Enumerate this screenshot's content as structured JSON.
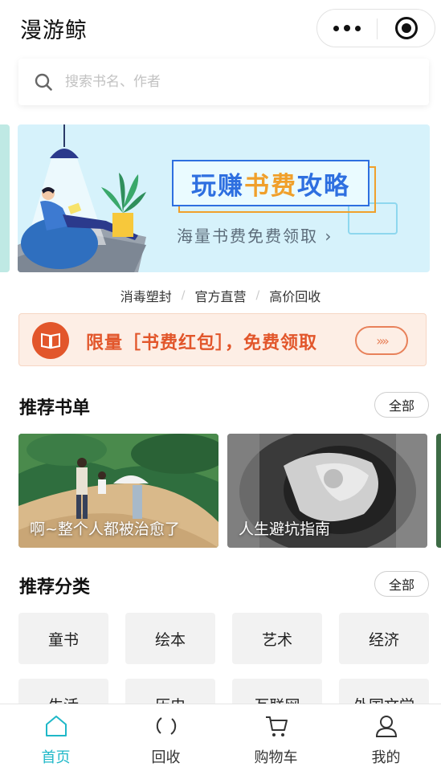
{
  "header": {
    "title": "漫游鲸"
  },
  "capsule": {
    "more_icon": "more-dots-icon",
    "close_icon": "target-icon"
  },
  "search": {
    "placeholder": "搜索书名、作者"
  },
  "banner": {
    "title_part1": "玩赚",
    "title_part2": "书费",
    "title_part3": "攻略",
    "subtitle": "海量书费免费领取 ›"
  },
  "tags": [
    "消毒塑封",
    "官方直营",
    "高价回收"
  ],
  "promo": {
    "text": "限量［书费红包］，免费领取",
    "arrow": "»»"
  },
  "booklists": {
    "title": "推荐书单",
    "all_label": "全部",
    "items": [
      {
        "caption": "啊~整个人都被治愈了"
      },
      {
        "caption": "人生避坑指南"
      }
    ]
  },
  "categories": {
    "title": "推荐分类",
    "all_label": "全部",
    "items": [
      "童书",
      "绘本",
      "艺术",
      "经济",
      "生活",
      "历史",
      "互联网",
      "外国文学"
    ]
  },
  "tabbar": {
    "items": [
      {
        "label": "首页",
        "icon": "home-icon",
        "active": true
      },
      {
        "label": "回收",
        "icon": "recycle-icon",
        "active": false
      },
      {
        "label": "购物车",
        "icon": "cart-icon",
        "active": false
      },
      {
        "label": "我的",
        "icon": "user-icon",
        "active": false
      }
    ]
  },
  "colors": {
    "accent": "#1fb8c8",
    "promo": "#e2562b",
    "banner_bg": "#d6f2fb"
  }
}
